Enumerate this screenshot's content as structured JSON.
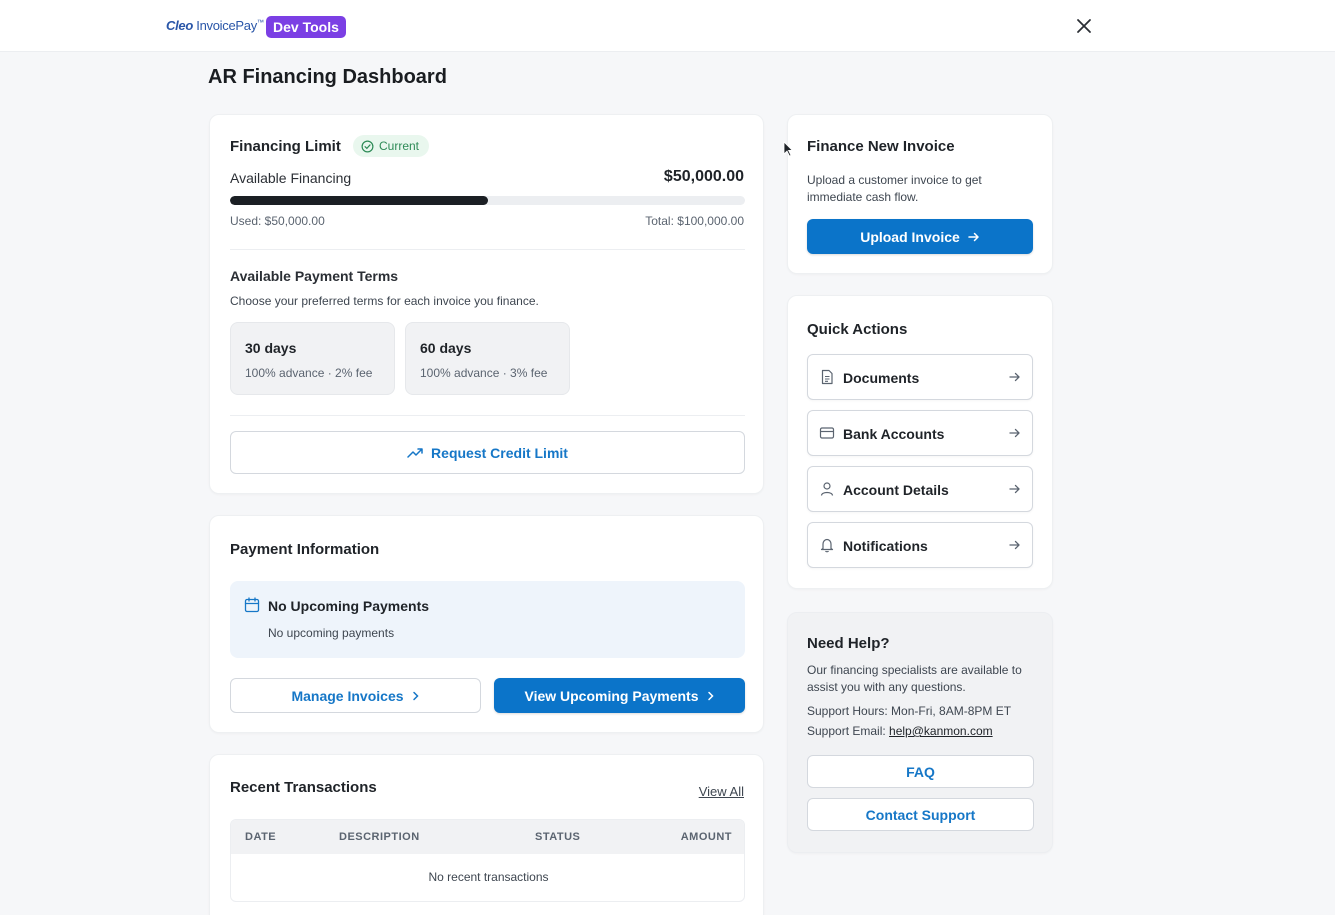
{
  "header": {
    "logo_cleo": "Cleo",
    "logo_product": "InvoicePay",
    "logo_tm": "™",
    "dev_tools_label": "Dev Tools",
    "close_icon": "close-icon"
  },
  "page_title": "AR Financing Dashboard",
  "financing_limit": {
    "title": "Financing Limit",
    "status": "Current",
    "status_color": "#2e8b57",
    "available_label": "Available Financing",
    "available_value": "$50,000.00",
    "used_label": "Used: $50,000.00",
    "total_label": "Total: $100,000.00",
    "usage_fraction": 0.5
  },
  "payment_terms": {
    "title": "Available Payment Terms",
    "subtitle": "Choose your preferred terms for each invoice you finance.",
    "terms": [
      {
        "name": "30 days",
        "desc": "100% advance · 2% fee"
      },
      {
        "name": "60 days",
        "desc": "100% advance · 3% fee"
      }
    ],
    "request_button": "Request Credit Limit"
  },
  "payment_info": {
    "title": "Payment Information",
    "box_title": "No Upcoming Payments",
    "box_text": "No upcoming payments",
    "manage_button": "Manage Invoices",
    "view_button": "View Upcoming Payments"
  },
  "transactions": {
    "title": "Recent Transactions",
    "view_all": "View All",
    "columns": [
      "DATE",
      "DESCRIPTION",
      "STATUS",
      "AMOUNT"
    ],
    "empty_text": "No recent transactions"
  },
  "finance_invoice": {
    "title": "Finance New Invoice",
    "text": "Upload a customer invoice to get immediate cash flow.",
    "button": "Upload Invoice"
  },
  "quick_actions": {
    "title": "Quick Actions",
    "items": [
      {
        "label": "Documents",
        "icon": "document-icon"
      },
      {
        "label": "Bank Accounts",
        "icon": "credit-card-icon"
      },
      {
        "label": "Account Details",
        "icon": "user-icon"
      },
      {
        "label": "Notifications",
        "icon": "bell-icon"
      }
    ]
  },
  "help": {
    "title": "Need Help?",
    "text": "Our financing specialists are available to assist you with any questions.",
    "hours": "Support Hours: Mon-Fri, 8AM-8PM ET",
    "email_label": "Support Email: ",
    "email": "help@kanmon.com",
    "faq_button": "FAQ",
    "contact_button": "Contact Support"
  },
  "colors": {
    "primary": "#0b74c9",
    "dev_tools": "#7b3fe4",
    "success": "#2e8b57"
  }
}
